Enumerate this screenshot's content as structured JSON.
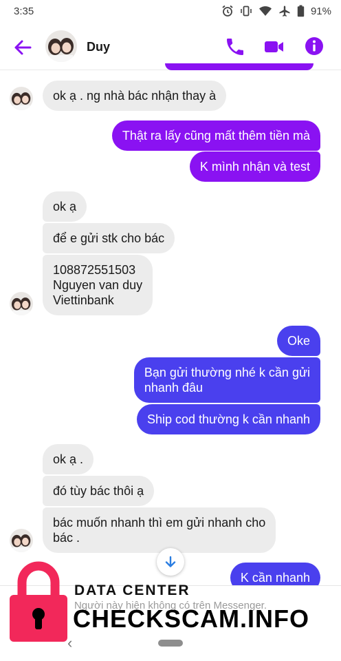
{
  "status_bar": {
    "time": "3:35",
    "battery": "91%"
  },
  "header": {
    "contact_name": "Duy"
  },
  "messages": [
    {
      "side": "in",
      "text": "ok ạ . ng nhà bác nhận thay à"
    },
    {
      "side": "out",
      "text": "Thật ra lấy cũng mất thêm tiền mà"
    },
    {
      "side": "out",
      "text": "K mình nhận và test"
    },
    {
      "side": "in",
      "text": "ok ạ"
    },
    {
      "side": "in",
      "text": "để e gửi stk cho bác"
    },
    {
      "side": "in",
      "lines": [
        "108872551503",
        "Nguyen van duy",
        "Viettinbank"
      ]
    },
    {
      "side": "out",
      "text": "Oke"
    },
    {
      "side": "out",
      "lines": [
        "Bạn gửi thường nhé k cần gửi",
        "nhanh đâu"
      ]
    },
    {
      "side": "out",
      "text": "Ship cod thường k cần nhanh"
    },
    {
      "side": "in",
      "text": "ok ạ ."
    },
    {
      "side": "in",
      "text": "đó tùy bác thôi ạ"
    },
    {
      "side": "in",
      "lines": [
        "bác muốn nhanh thì em gửi nhanh cho",
        "bác ."
      ]
    },
    {
      "side": "out",
      "text": "K cần nhanh"
    }
  ],
  "footer": {
    "unavailable_text": "Người này hiện không có trên Messenger."
  },
  "watermark": {
    "line1": "DATA CENTER",
    "line2": "CHECKSCAM.INFO"
  },
  "colors": {
    "accent": "#8a12f2",
    "outgoing_purple": "#8a12f2",
    "outgoing_blue": "#4a40ee",
    "incoming": "#ececec",
    "watermark_lock": "#f2285a"
  },
  "icons": [
    "alarm-icon",
    "vibrate-icon",
    "wifi-icon",
    "airplane-icon",
    "battery-icon",
    "back-arrow-icon",
    "phone-icon",
    "video-camera-icon",
    "info-icon",
    "arrow-down-icon",
    "lock-icon"
  ]
}
